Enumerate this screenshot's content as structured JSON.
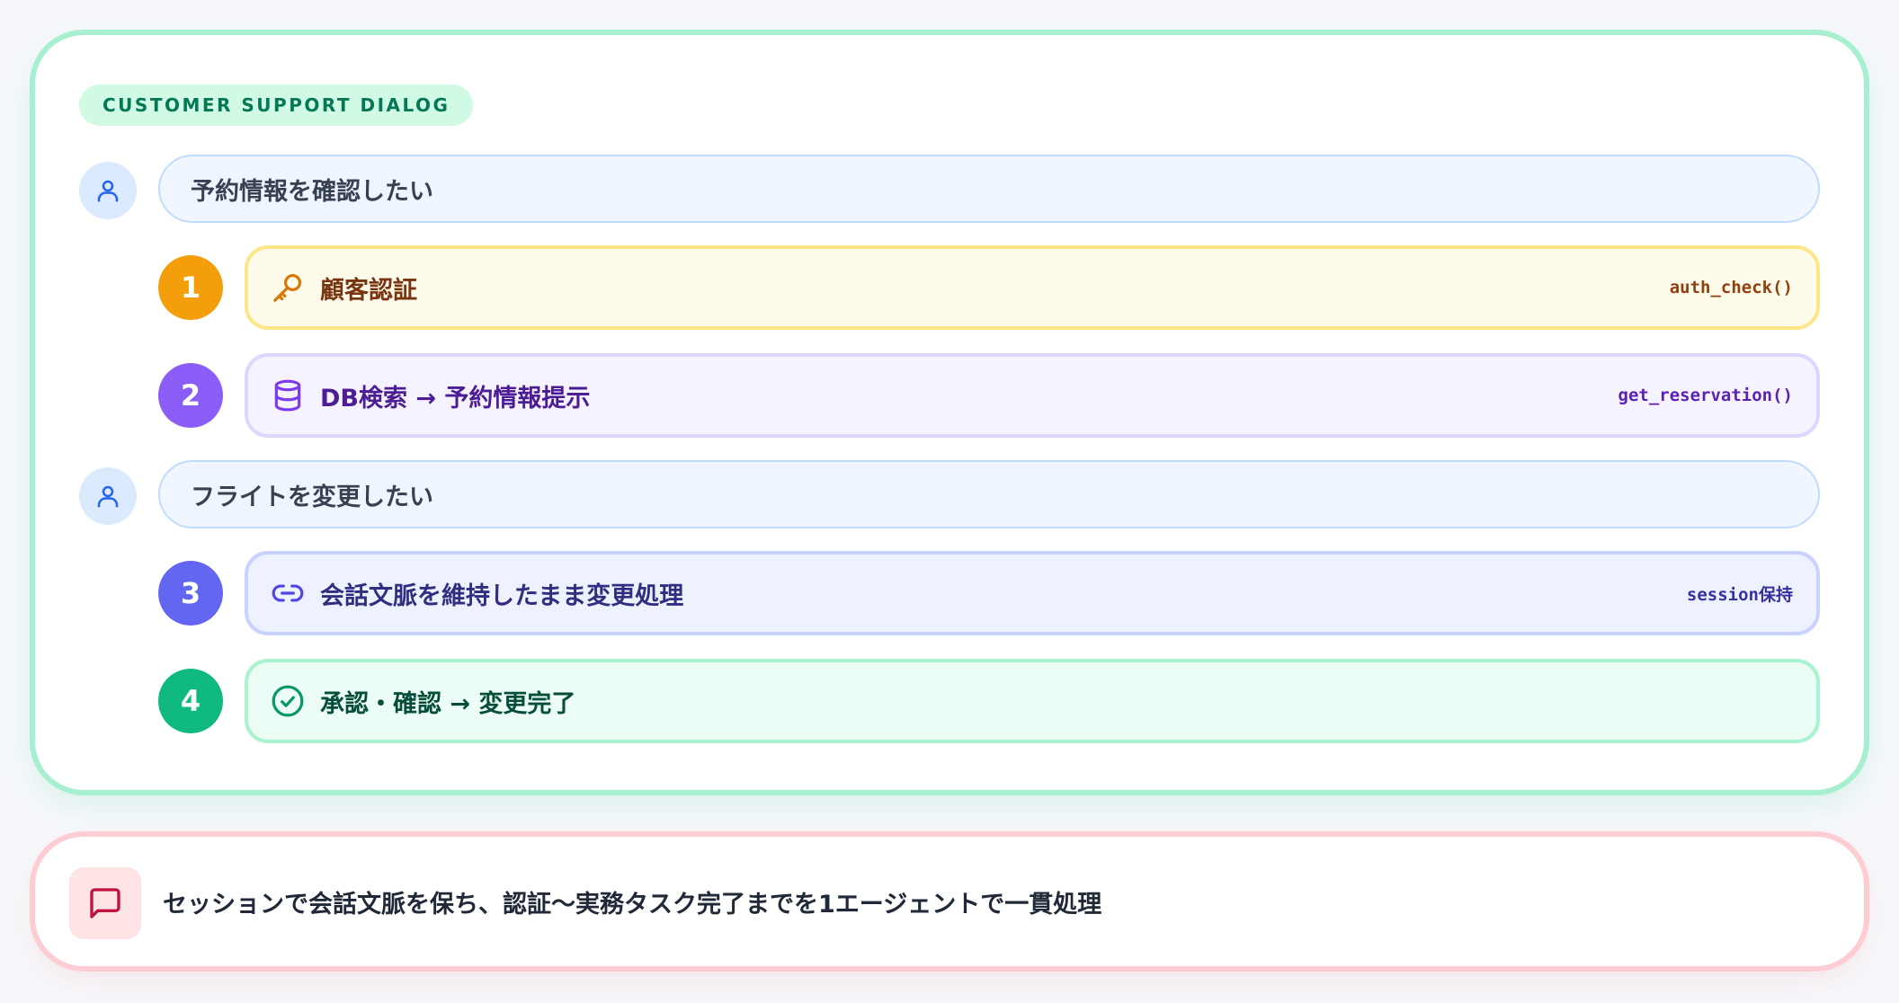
{
  "badge": "CUSTOMER SUPPORT DIALOG",
  "user_messages": [
    "予約情報を確認したい",
    "フライトを変更したい"
  ],
  "steps": [
    {
      "number": "1",
      "icon": "key-icon",
      "label": "顧客認証",
      "code": "auth_check()",
      "color": "#f59e0b"
    },
    {
      "number": "2",
      "icon": "database-icon",
      "label": "DB検索 → 予約情報提示",
      "code": "get_reservation()",
      "color": "#8b5cf6"
    },
    {
      "number": "3",
      "icon": "link-icon",
      "label": "会話文脈を維持したまま変更処理",
      "code": "session保持",
      "color": "#6366f1"
    },
    {
      "number": "4",
      "icon": "check-circle-icon",
      "label": "承認・確認 → 変更完了",
      "color": "#10b981"
    }
  ],
  "summary": {
    "icon": "message-icon",
    "text": "セッションで会話文脈を保ち、認証〜実務タスク完了までを1エージェントで一貫処理"
  }
}
